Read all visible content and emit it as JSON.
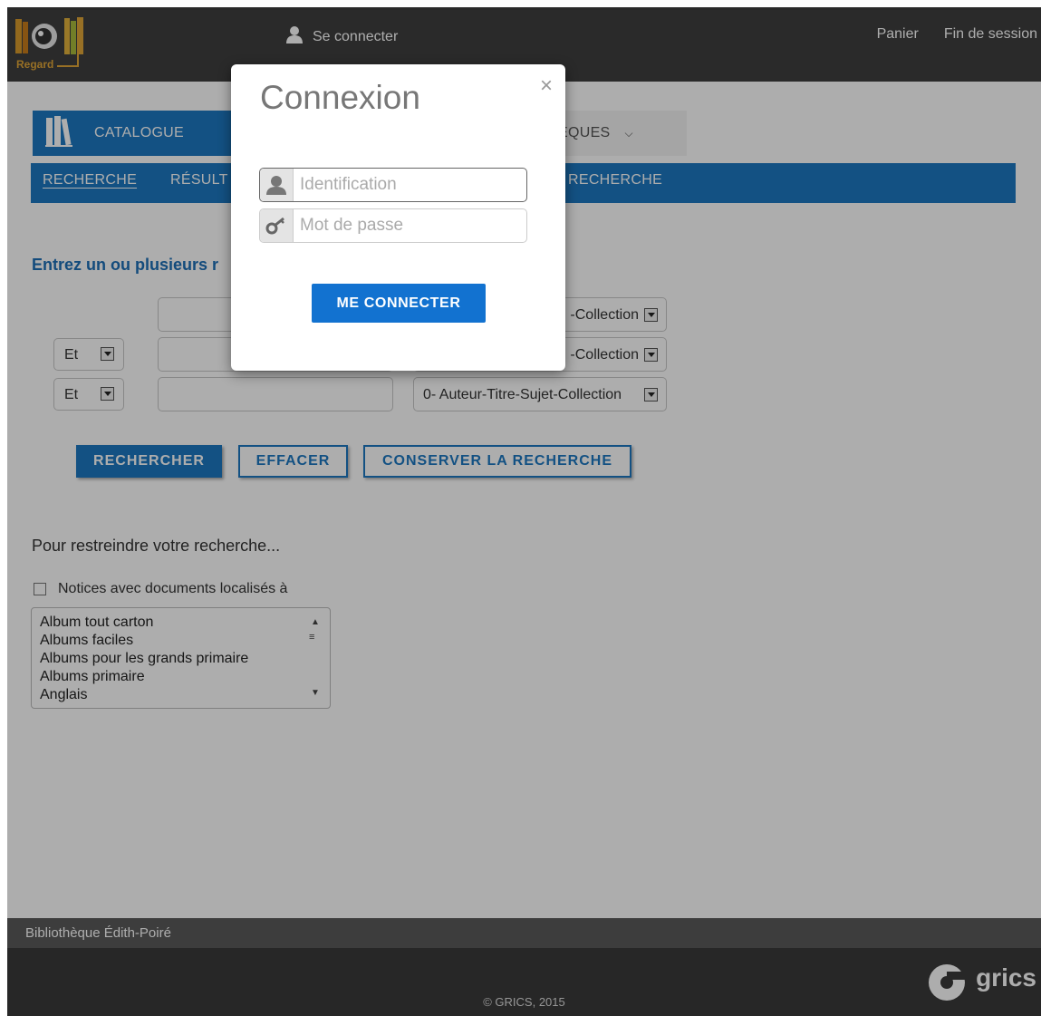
{
  "header": {
    "logo_text": "Regard",
    "connect_label": "Se connecter",
    "cart_label": "Panier",
    "logout_label": "Fin de session"
  },
  "nav": {
    "catalogue_label": "CATALOGUE",
    "libraries_label_visible": "ÈQUES"
  },
  "subnav": {
    "items": [
      "RECHERCHE",
      "RÉSULT",
      "RECHERCHE"
    ]
  },
  "search": {
    "instructions": "Entrez un ou plusieurs r",
    "rows": [
      {
        "operator": "",
        "term": "",
        "field": "-Collection"
      },
      {
        "operator": "Et",
        "term": "",
        "field": "-Collection"
      },
      {
        "operator": "Et",
        "term": "",
        "field": "0- Auteur-Titre-Sujet-Collection"
      }
    ],
    "search_button": "RECHERCHER",
    "clear_button": "EFFACER",
    "save_button": "CONSERVER LA RECHERCHE"
  },
  "restrict": {
    "title": "Pour restreindre votre recherche...",
    "checkbox_label": "Notices avec documents localisés à",
    "checked": false,
    "locations": [
      "Album tout carton",
      "Albums faciles",
      "Albums pour les grands primaire",
      "Albums primaire",
      "Anglais"
    ]
  },
  "footer": {
    "library_name": "Bibliothèque Édith-Poiré",
    "copyright": "© GRICS, 2015",
    "brand": "grics"
  },
  "modal": {
    "title": "Connexion",
    "close_glyph": "×",
    "username_placeholder": "Identification",
    "password_placeholder": "Mot de passe",
    "submit_label": "ME CONNECTER"
  },
  "colors": {
    "header_bg": "#3e3e3e",
    "accent": "#1d78c1",
    "modal_button": "#1272d0",
    "overlay": "rgba(0,0,0,0.32)"
  }
}
